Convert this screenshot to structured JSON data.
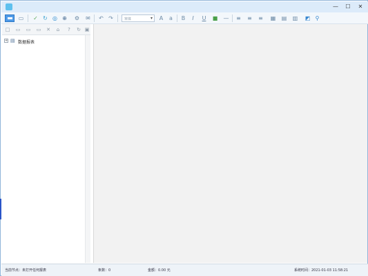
{
  "titlebar": {
    "title": "",
    "buttons": {
      "minimize": "—",
      "maximize": "☐",
      "close": "✕"
    }
  },
  "toolbar": {
    "icons": [
      "new-icon",
      "open-icon",
      "save-icon",
      "refresh-icon",
      "print-icon",
      "export-icon",
      "undo-icon",
      "redo-icon",
      "align-left-icon",
      "bold-icon",
      "italic-icon",
      "underline-icon",
      "color-icon",
      "line-icon",
      "table-icon",
      "grid-icon",
      "chart-icon",
      "image-icon",
      "link-icon",
      "settings-icon"
    ],
    "font_combo": {
      "value": "宋体"
    }
  },
  "left_panel": {
    "tree": [
      {
        "expander": "+",
        "icon": "database-icon",
        "label": "数据报表"
      }
    ]
  },
  "statusbar": {
    "current_node": "当前节点：未打开任何报表",
    "rows": "条数：0",
    "amount": "金额：0.00 元",
    "datetime": "系统时间：2021-01-03 11:58:21"
  },
  "colors": {
    "titlebar_bg": "#dcebfa",
    "toolbar_bg": "#f3f7fb",
    "main_bg": "#f2f2f2",
    "accent": "#4f9be8",
    "statusbar_bg": "#eef3f8"
  }
}
